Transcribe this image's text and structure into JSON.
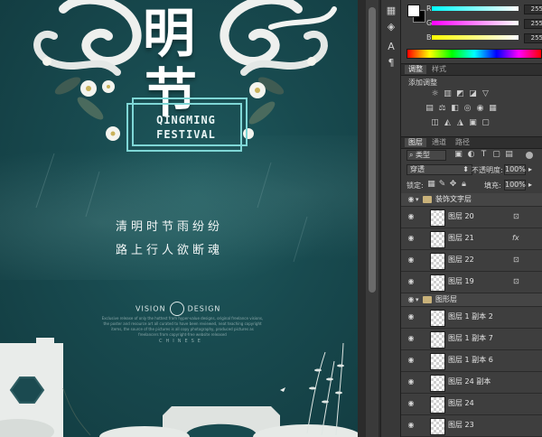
{
  "canvas": {
    "title_char_1": "明",
    "title_char_2": "节",
    "english_line_1": "QINGMING",
    "english_line_2": "FESTIVAL",
    "poem_line_1": "清明时节雨纷纷",
    "poem_line_2": "路上行人欲断魂",
    "vision_left": "VISION",
    "vision_right": "DESIGN",
    "small_text": "Exclusive release of only the hottest from hyper-value designs, original freelance visions, the poster and resource art all curated to have been reviewed, neat teaching copyright items, the source of the pictures is all copy photography, produced pictures as freelancers from copyright-free website released",
    "chinese_label": "CHINESE",
    "colors": {
      "background": "#184a4f",
      "frame": "#7fd7d6",
      "text": "#ffffff"
    }
  },
  "toolstrip": {
    "icons": [
      "swatches-icon",
      "layers-icon",
      "character-icon",
      "paragraph-icon"
    ]
  },
  "color_panel": {
    "r_label": "R",
    "g_label": "G",
    "b_label": "B",
    "r_value": "255",
    "g_value": "255",
    "b_value": "255"
  },
  "adjust_panel": {
    "tab_adjust": "调整",
    "tab_style": "样式",
    "add_label": "添加调整"
  },
  "layers_panel": {
    "tab_layers": "图层",
    "tab_channels": "通道",
    "tab_paths": "路径",
    "filter_kind": "类型",
    "blend_mode": "穿透",
    "opacity_label": "不透明度:",
    "opacity_value": "100%",
    "lock_label": "锁定:",
    "fill_label": "填充:",
    "fill_value": "100%",
    "layers": [
      {
        "name": "装饰文字层",
        "type": "group"
      },
      {
        "name": "图层 20",
        "type": "layer",
        "badge": "lock"
      },
      {
        "name": "图层 21",
        "type": "layer",
        "badge": "fx"
      },
      {
        "name": "图层 22",
        "type": "layer",
        "badge": "lock"
      },
      {
        "name": "图层 19",
        "type": "layer",
        "badge": "lock"
      },
      {
        "name": "图形层",
        "type": "group"
      },
      {
        "name": "图层 1 副本 2",
        "type": "layer"
      },
      {
        "name": "图层 1 副本 7",
        "type": "layer"
      },
      {
        "name": "图层 1 副本 6",
        "type": "layer"
      },
      {
        "name": "图层 24 副本",
        "type": "layer"
      },
      {
        "name": "图层 24",
        "type": "layer"
      },
      {
        "name": "图层 23",
        "type": "layer"
      }
    ]
  }
}
